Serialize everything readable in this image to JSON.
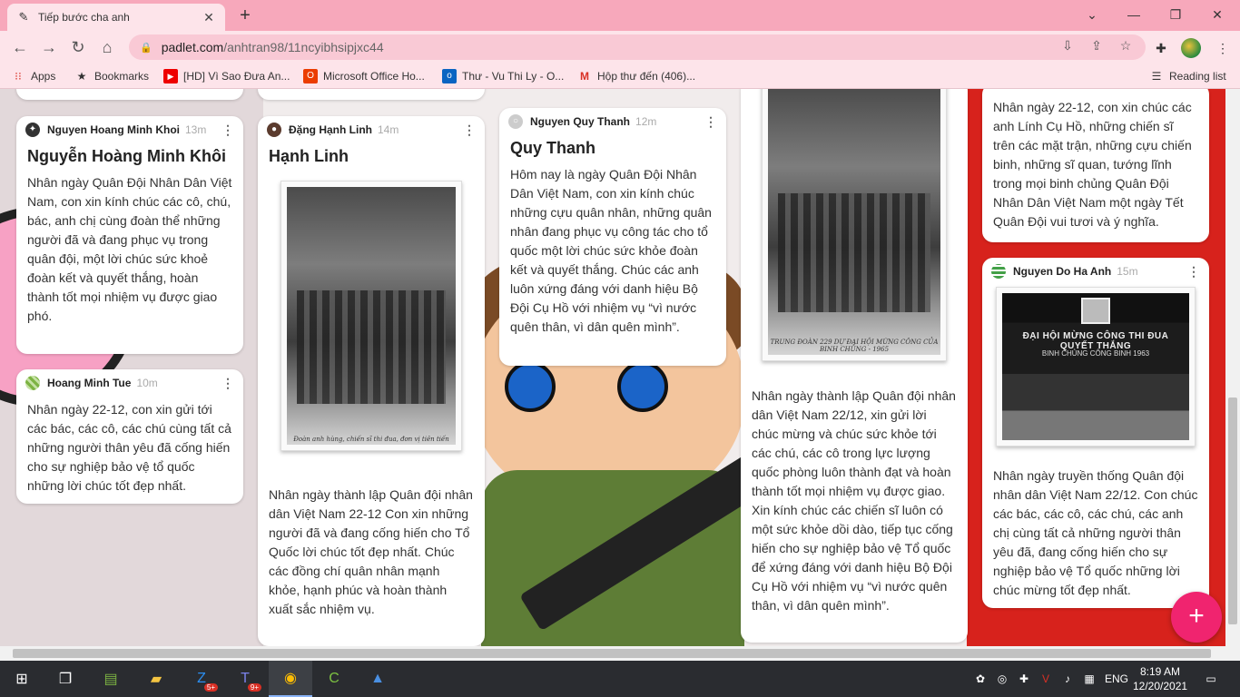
{
  "browser": {
    "tab_title": "Tiếp bước cha anh",
    "url_host": "padlet.com",
    "url_path": "/anhtran98/11ncyibhsipjxc44",
    "bookmarks": [
      {
        "label": "Apps",
        "icon": "apps-grid-icon"
      },
      {
        "label": "Bookmarks",
        "icon": "star-icon"
      },
      {
        "label": "[HD] Vì Sao Đưa An...",
        "icon": "youtube-icon"
      },
      {
        "label": "Microsoft Office Ho...",
        "icon": "office-icon"
      },
      {
        "label": "Thư - Vu Thi Ly - O...",
        "icon": "outlook-icon"
      },
      {
        "label": "Hộp thư đến (406)...",
        "icon": "gmail-icon"
      }
    ],
    "reading_list": "Reading list"
  },
  "posts": {
    "khoi": {
      "author": "Nguyen Hoang Minh Khoi",
      "time": "13m",
      "title": "Nguyễn Hoàng Minh Khôi",
      "body": "Nhân ngày Quân Đội Nhân Dân Việt Nam, con xin kính chúc các cô, chú, bác, anh chị cùng đoàn thể những người đã và đang phục vụ trong quân đội, một lời chúc sức khoẻ đoàn kết và quyết thắng, hoàn thành tốt mọi nhiệm vụ được giao phó."
    },
    "tue": {
      "author": "Hoang Minh Tue",
      "time": "10m",
      "body": "Nhân ngày 22-12, con xin gửi tới các bác, các cô, các chú cùng tất cả những người thân yêu đã cống hiến cho sự nghiệp bảo vệ tổ quốc những lời chúc tốt đẹp nhất."
    },
    "linh": {
      "author": "Đặng Hạnh Linh",
      "time": "14m",
      "title": "Hạnh Linh",
      "body": "Nhân ngày thành lập Quân đội nhân dân Việt Nam 22-12 Con xin những người đã và đang cống hiến cho Tổ Quốc lời chúc tốt đẹp nhất. Chúc các đồng chí quân nhân mạnh khỏe, hạnh phúc và hoàn thành xuất sắc nhiệm vụ."
    },
    "thanh": {
      "author": "Nguyen Quy Thanh",
      "time": "12m",
      "title": "Quy Thanh",
      "body": "Hôm nay là ngày Quân Đội Nhân Dân Việt Nam, con xin kính chúc những cựu quân nhân, những quân nhân đang phục vụ công tác cho tổ quốc một lời chúc sức khỏe đoàn kết và quyết thắng. Chúc các anh luôn xứng đáng với danh hiệu Bộ Đội Cụ Hồ với nhiệm vụ “vì nước quên thân, vì dân quên mình”."
    },
    "col4": {
      "body": "Nhân ngày thành lập Quân đội nhân dân Việt Nam 22/12, xin gửi lời chúc mừng và chúc sức khỏe tới các chú, các cô trong lực lượng quốc phòng luôn thành đạt và hoàn thành tốt mọi nhiệm vụ được giao. Xin kính chúc các chiến sĩ luôn có một sức khỏe dồi dào, tiếp tục cống hiến cho sự nghiệp bảo vệ Tổ quốc để xứng đáng với danh hiệu Bộ Đội Cụ Hồ với nhiệm vụ “vì nước quên thân, vì dân quên mình”."
    },
    "col5": {
      "body": "Nhân ngày 22-12, con xin chúc các anh Lính Cụ Hồ, những chiến sĩ trên các mặt trận, những cựu chiến binh, những sĩ quan, tướng lĩnh trong mọi binh chủng Quân Đội Nhân Dân Việt Nam một ngày Tết Quân Đội vui tươi và ý nghĩa."
    },
    "ha_anh": {
      "author": "Nguyen Do Ha Anh",
      "time": "15m",
      "banner": "ĐẠI HỘI MỪNG CÔNG THI ĐUA QUYẾT THẮNG",
      "banner2": "BINH CHỦNG CÔNG BINH 1963",
      "body": "Nhân ngày truyền thống Quân đội nhân dân Việt Nam 22/12. Con chúc các bác, các cô, các chú, các anh chị cùng tất cả những người thân yêu đã, đang cống hiến cho sự nghiệp bảo vệ Tổ quốc những lời chúc mừng tốt đẹp nhất."
    }
  },
  "photo_caption": "Đoàn anh hùng, chiến sĩ thi đua, đơn vị tiên tiến",
  "photo_caption2": "TRUNG ĐOÀN 229 DỰ ĐẠI HỘI MỪNG CÔNG CỦA BINH CHỦNG - 1965",
  "fab_label": "+",
  "taskbar": {
    "time": "8:19 AM",
    "date": "12/20/2021",
    "lang": "ENG",
    "zalo_badge": "5+",
    "teams_badge": "9+"
  },
  "colors": {
    "chrome_pink": "#f7a8bb",
    "fab": "#f0246f",
    "flag_red": "#d7221c"
  }
}
